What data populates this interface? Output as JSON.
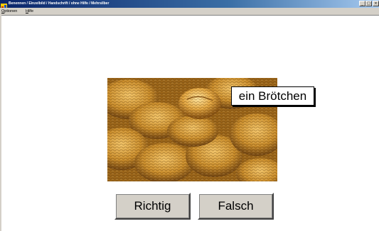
{
  "window": {
    "title": "Benennen / Einzelbild / Handschrift / ohne Hilfe / Mehrsilber",
    "controls": {
      "minimize": "_",
      "maximize": "□",
      "close": "×"
    }
  },
  "menu": {
    "items": [
      {
        "label": "Optionen",
        "accel": "O",
        "rest": "ptionen"
      },
      {
        "label": "Hilfe",
        "accel": "H",
        "rest": "ilfe"
      }
    ]
  },
  "exercise": {
    "image": {
      "subject": "Brötchen"
    },
    "word_label": "ein Brötchen",
    "buttons": {
      "correct": "Richtig",
      "wrong": "Falsch"
    }
  },
  "colors": {
    "titlebar_start": "#0a246a",
    "button_face": "#d4d0c8",
    "bread": "#c8902c"
  }
}
